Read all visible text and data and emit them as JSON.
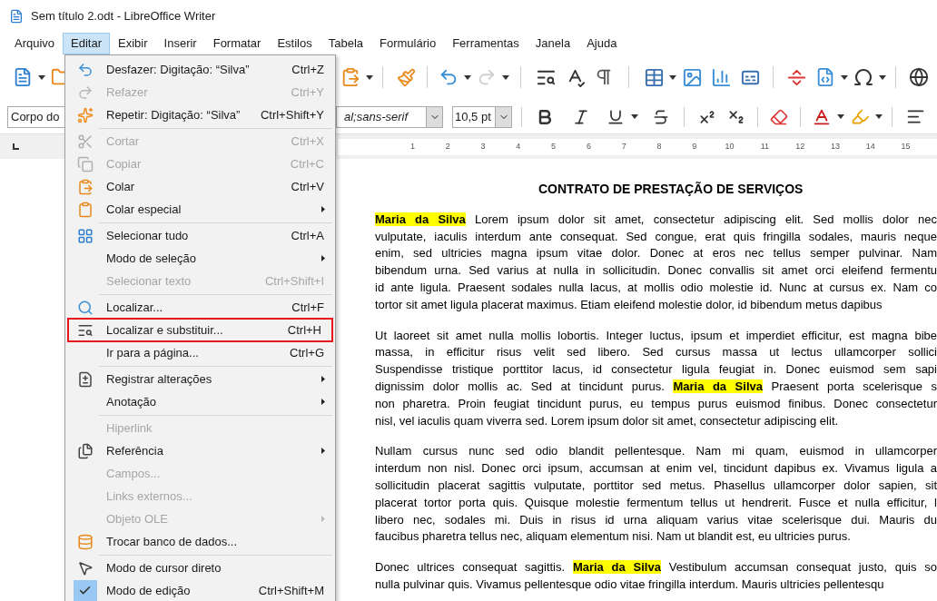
{
  "window": {
    "title": "Sem título 2.odt - LibreOffice Writer"
  },
  "menubar": [
    {
      "label": "Arquivo",
      "selected": false
    },
    {
      "label": "Editar",
      "selected": true
    },
    {
      "label": "Exibir",
      "selected": false
    },
    {
      "label": "Inserir",
      "selected": false
    },
    {
      "label": "Formatar",
      "selected": false
    },
    {
      "label": "Estilos",
      "selected": false
    },
    {
      "label": "Tabela",
      "selected": false
    },
    {
      "label": "Formulário",
      "selected": false
    },
    {
      "label": "Ferramentas",
      "selected": false
    },
    {
      "label": "Janela",
      "selected": false
    },
    {
      "label": "Ajuda",
      "selected": false
    }
  ],
  "toolbar": {
    "redo_disabled": true
  },
  "formatting": {
    "paragraph_style": "Corpo do",
    "font_name": "al;sans-serif",
    "font_size": "10,5 pt"
  },
  "ruler": [
    "1",
    "2",
    "3",
    "4",
    "5",
    "6",
    "7",
    "8",
    "9",
    "10",
    "11",
    "12",
    "13",
    "14",
    "15"
  ],
  "edit_menu": [
    {
      "kind": "item",
      "label": "Desfazer: Digitação: “Silva”",
      "shortcut": "Ctrl+Z",
      "disabled": false,
      "submenu": false,
      "checked": false,
      "outlined": false
    },
    {
      "kind": "item",
      "label": "Refazer",
      "shortcut": "Ctrl+Y",
      "disabled": true,
      "submenu": false,
      "checked": false,
      "outlined": false
    },
    {
      "kind": "item",
      "label": "Repetir: Digitação: “Silva”",
      "shortcut": "Ctrl+Shift+Y",
      "disabled": false,
      "submenu": false,
      "checked": false,
      "outlined": false
    },
    {
      "kind": "separator"
    },
    {
      "kind": "item",
      "label": "Cortar",
      "shortcut": "Ctrl+X",
      "disabled": true,
      "submenu": false,
      "checked": false,
      "outlined": false
    },
    {
      "kind": "item",
      "label": "Copiar",
      "shortcut": "Ctrl+C",
      "disabled": true,
      "submenu": false,
      "checked": false,
      "outlined": false
    },
    {
      "kind": "item",
      "label": "Colar",
      "shortcut": "Ctrl+V",
      "disabled": false,
      "submenu": false,
      "checked": false,
      "outlined": false
    },
    {
      "kind": "item",
      "label": "Colar especial",
      "disabled": false,
      "submenu": true,
      "checked": false,
      "outlined": false
    },
    {
      "kind": "separator"
    },
    {
      "kind": "item",
      "label": "Selecionar tudo",
      "shortcut": "Ctrl+A",
      "disabled": false,
      "submenu": false,
      "checked": false,
      "outlined": false
    },
    {
      "kind": "item",
      "label": "Modo de seleção",
      "disabled": false,
      "submenu": true,
      "checked": false,
      "outlined": false
    },
    {
      "kind": "item",
      "label": "Selecionar texto",
      "shortcut": "Ctrl+Shift+I",
      "disabled": true,
      "submenu": false,
      "checked": false,
      "outlined": false
    },
    {
      "kind": "separator"
    },
    {
      "kind": "item",
      "label": "Localizar...",
      "shortcut": "Ctrl+F",
      "disabled": false,
      "submenu": false,
      "checked": false,
      "outlined": false
    },
    {
      "kind": "item",
      "label": "Localizar e substituir...",
      "shortcut": "Ctrl+H",
      "disabled": false,
      "submenu": false,
      "checked": false,
      "outlined": true
    },
    {
      "kind": "item",
      "label": "Ir para a página...",
      "shortcut": "Ctrl+G",
      "disabled": false,
      "submenu": false,
      "checked": false,
      "outlined": false
    },
    {
      "kind": "separator"
    },
    {
      "kind": "item",
      "label": "Registrar alterações",
      "disabled": false,
      "submenu": true,
      "checked": false,
      "outlined": false
    },
    {
      "kind": "item",
      "label": "Anotação",
      "disabled": false,
      "submenu": true,
      "checked": false,
      "outlined": false
    },
    {
      "kind": "separator"
    },
    {
      "kind": "item",
      "label": "Hiperlink",
      "disabled": true,
      "submenu": false,
      "checked": false,
      "outlined": false
    },
    {
      "kind": "item",
      "label": "Referência",
      "disabled": false,
      "submenu": true,
      "checked": false,
      "outlined": false
    },
    {
      "kind": "item",
      "label": "Campos...",
      "disabled": true,
      "submenu": false,
      "checked": false,
      "outlined": false
    },
    {
      "kind": "item",
      "label": "Links externos...",
      "disabled": true,
      "submenu": false,
      "checked": false,
      "outlined": false
    },
    {
      "kind": "item",
      "label": "Objeto OLE",
      "disabled": true,
      "submenu": true,
      "checked": false,
      "outlined": false
    },
    {
      "kind": "item",
      "label": "Trocar banco de dados...",
      "disabled": false,
      "submenu": false,
      "checked": false,
      "outlined": false
    },
    {
      "kind": "separator"
    },
    {
      "kind": "item",
      "label": "Modo de cursor direto",
      "disabled": false,
      "submenu": false,
      "checked": false,
      "outlined": false
    },
    {
      "kind": "item",
      "label": "Modo de edição",
      "shortcut": "Ctrl+Shift+M",
      "disabled": false,
      "submenu": false,
      "checked": true,
      "outlined": false
    }
  ],
  "document": {
    "title": "CONTRATO DE PRESTAÇÃO DE SERVIÇOS",
    "paragraphs": [
      {
        "lines": [
          [
            {
              "text": "Maria da Silva",
              "highlighted": true
            },
            {
              "text": " Lorem ipsum dolor sit amet, consectetur adipiscing elit. Sed mollis dolor nec",
              "highlighted": false
            }
          ],
          [
            {
              "text": "vulputate, iaculis interdum ante consequat. Sed congue, erat quis fringilla sodales, mauris neque",
              "highlighted": false
            }
          ],
          [
            {
              "text": "enim, sed ultricies magna ipsum vitae dolor. Donec at eros nec tellus semper pulvinar. Nam",
              "highlighted": false
            }
          ],
          [
            {
              "text": "bibendum urna. Sed varius at nulla in sollicitudin. Donec convallis sit amet orci eleifend fermentu",
              "highlighted": false
            }
          ],
          [
            {
              "text": "id ante ligula. Praesent sodales nulla lacus, at mollis odio molestie id. Nunc at cursus ex. Nam co",
              "highlighted": false
            }
          ],
          [
            {
              "text": "tortor sit amet ligula placerat maximus. Etiam eleifend molestie dolor, id bibendum metus dapibus",
              "highlighted": false
            }
          ]
        ]
      },
      {
        "lines": [
          [
            {
              "text": "Ut laoreet sit amet nulla mollis lobortis. Integer luctus, ipsum et imperdiet efficitur, est magna bibe",
              "highlighted": false
            }
          ],
          [
            {
              "text": "massa, in efficitur risus velit sed libero. Sed cursus massa ut lectus ullamcorper sollici",
              "highlighted": false
            }
          ],
          [
            {
              "text": "Suspendisse tristique porttitor lacus, id consectetur ligula feugiat in. Donec euismod sem sapi",
              "highlighted": false
            }
          ],
          [
            {
              "text": "dignissim dolor mollis ac. Sed at tincidunt purus. ",
              "highlighted": false
            },
            {
              "text": "Maria da Silva",
              "highlighted": true
            },
            {
              "text": " Praesent porta scelerisque s",
              "highlighted": false
            }
          ],
          [
            {
              "text": "non pharetra. Proin feugiat tincidunt purus, eu tempus purus euismod finibus. Donec consectetur",
              "highlighted": false
            }
          ],
          [
            {
              "text": "nisl, vel iaculis quam viverra sed. Lorem ipsum dolor sit amet, consectetur adipiscing elit.",
              "highlighted": false
            }
          ]
        ]
      },
      {
        "lines": [
          [
            {
              "text": "Nullam cursus nunc sed odio blandit pellentesque. Nam mi quam, euismod in ullamcorper",
              "highlighted": false
            }
          ],
          [
            {
              "text": "interdum non nisl. Donec orci ipsum, accumsan at enim vel, tincidunt dapibus ex. Vivamus ligula a",
              "highlighted": false
            }
          ],
          [
            {
              "text": "sollicitudin placerat sagittis vulputate, porttitor sed metus. Phasellus ullamcorper dolor sapien, sit",
              "highlighted": false
            }
          ],
          [
            {
              "text": "placerat tortor porta quis. Quisque molestie fermentum tellus ut hendrerit. Fusce et nulla efficitur, l",
              "highlighted": false
            }
          ],
          [
            {
              "text": "libero nec, sodales mi. Duis in risus id urna aliquam varius vitae scelerisque dui. Mauris du",
              "highlighted": false
            }
          ],
          [
            {
              "text": "faucibus pharetra tellus nec, aliquam elementum nisi. Nam ut blandit est, eu ultricies purus.",
              "highlighted": false
            }
          ]
        ]
      },
      {
        "lines": [
          [
            {
              "text": "Donec ultrices consequat sagittis. ",
              "highlighted": false
            },
            {
              "text": "Maria da Silva",
              "highlighted": true
            },
            {
              "text": " Vestibulum accumsan consequat justo, quis so",
              "highlighted": false
            }
          ],
          [
            {
              "text": "nulla pulvinar quis. Vivamus pellentesque odio vitae fringilla interdum. Mauris ultricies pellentesqu",
              "highlighted": false
            }
          ]
        ]
      }
    ]
  }
}
